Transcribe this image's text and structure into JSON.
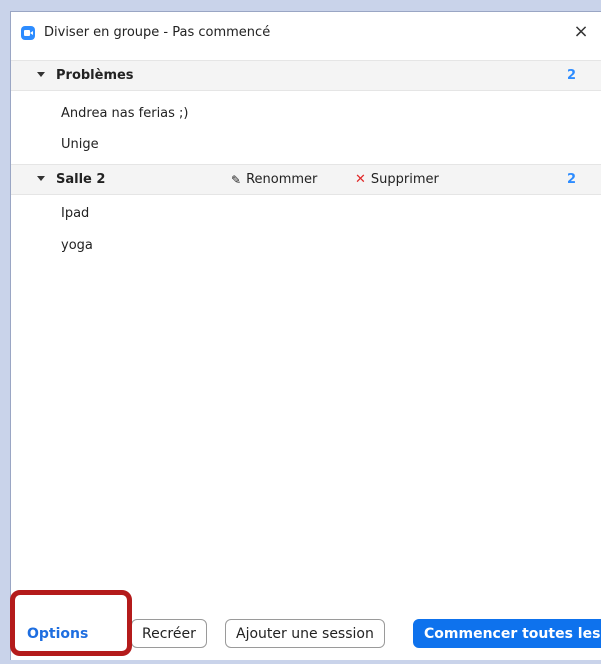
{
  "window": {
    "title": "Diviser en groupe - Pas commencé",
    "close_label": "×"
  },
  "groups": [
    {
      "name": "Problèmes",
      "count": "2",
      "members": [
        "Andrea nas ferias ;)",
        "Unige"
      ]
    },
    {
      "name": "Salle 2",
      "count": "2",
      "rename_label": "Renommer",
      "delete_label": "Supprimer",
      "members": [
        "Ipad",
        "yoga"
      ]
    }
  ],
  "footer": {
    "options_label": "Options",
    "recreate_label": "Recréer",
    "add_session_label": "Ajouter une session",
    "start_all_label": "Commencer toutes les sessions"
  },
  "colors": {
    "accent": "#2d8cff",
    "primary_button": "#0e72ed",
    "delete_x": "#e02828",
    "highlight_box": "#b41b1b"
  }
}
